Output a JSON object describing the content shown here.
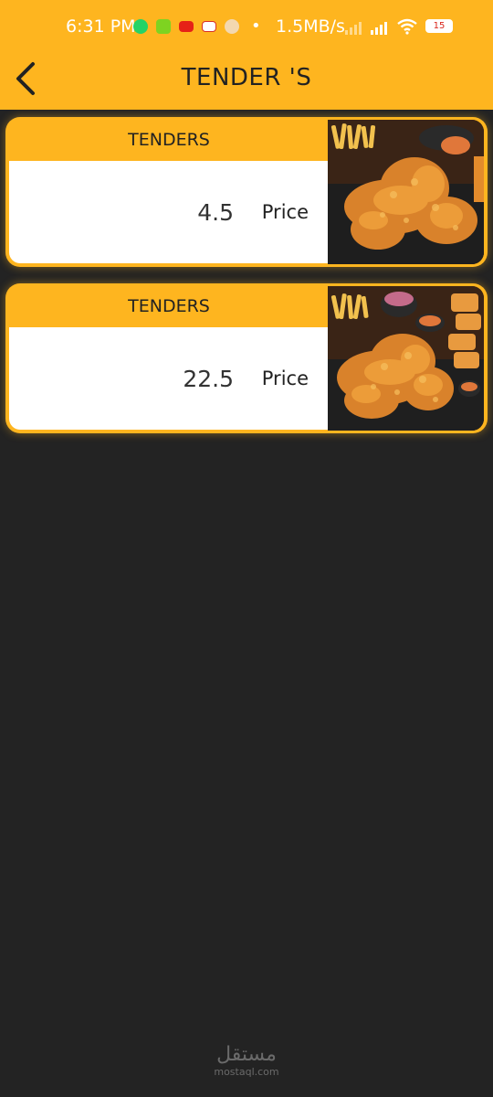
{
  "status_bar": {
    "time": "6:31 PM",
    "separator": "•",
    "network_speed": "1.5MB/s",
    "battery": "15",
    "notification_icons": [
      "whatsapp-icon",
      "app-d-icon",
      "youtube-icon",
      "gmail-icon",
      "app-circle-icon"
    ]
  },
  "app_bar": {
    "title": "TENDER 'S",
    "back_icon": "chevron-left-icon"
  },
  "colors": {
    "accent": "#FEB51F",
    "background": "#232323",
    "card_body": "#FFFFFF",
    "text_dark": "#222222"
  },
  "items": [
    {
      "name": "TENDERS",
      "price": "4.5",
      "price_label": "Price",
      "image": "fried-chicken-tenders-photo"
    },
    {
      "name": "TENDERS",
      "price": "22.5",
      "price_label": "Price",
      "image": "fried-chicken-tenders-platter-photo"
    }
  ],
  "watermark": {
    "arabic": "مستقل",
    "latin": "mostaql.com"
  }
}
